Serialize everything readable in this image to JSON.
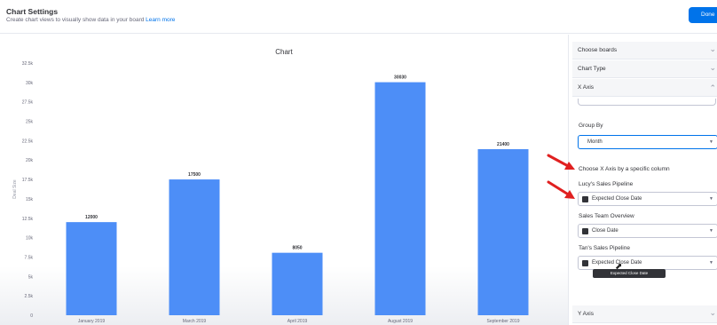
{
  "header": {
    "title": "Chart Settings",
    "subtitle": "Create chart views to visually show data in your board",
    "learn_more": "Learn more",
    "done_label": "Done"
  },
  "chart_data": {
    "type": "bar",
    "title": "Chart",
    "xlabel": "",
    "ylabel": "Deal Size",
    "categories": [
      "January 2019",
      "March 2019",
      "April 2019",
      "August 2019",
      "September 2019"
    ],
    "values": [
      12000,
      17500,
      8050,
      30030,
      21400
    ],
    "data_labels": [
      "12000",
      "17500",
      "8050",
      "30030",
      "21400"
    ],
    "y_ticks": [
      "0",
      "2.5k",
      "5k",
      "7.5k",
      "10k",
      "12.5k",
      "15k",
      "17.5k",
      "20k",
      "22.5k",
      "25k",
      "27.5k",
      "30k",
      "32.5k"
    ],
    "ylim": [
      0,
      32500
    ],
    "grid": false,
    "bar_color": "#4d8ef7"
  },
  "sidebar": {
    "choose_boards": "Choose boards",
    "chart_type": "Chart Type",
    "x_axis": "X Axis",
    "group_by_label": "Group By",
    "group_by_value": "Month",
    "choose_x_axis_label": "Choose X Axis by a specific column",
    "boards": [
      {
        "name": "Lucy's Sales Pipeline",
        "column": "Expected Close Date"
      },
      {
        "name": "Sales Team Overview",
        "column": "Close Date"
      },
      {
        "name": "Tan's Sales Pipeline",
        "column": "Expected Close Date"
      }
    ],
    "tooltip": "Expected Close Date",
    "y_axis": "Y Axis"
  },
  "colors": {
    "accent": "#0073ea",
    "bar": "#4d8ef7",
    "annotation_arrow": "#e02020"
  }
}
